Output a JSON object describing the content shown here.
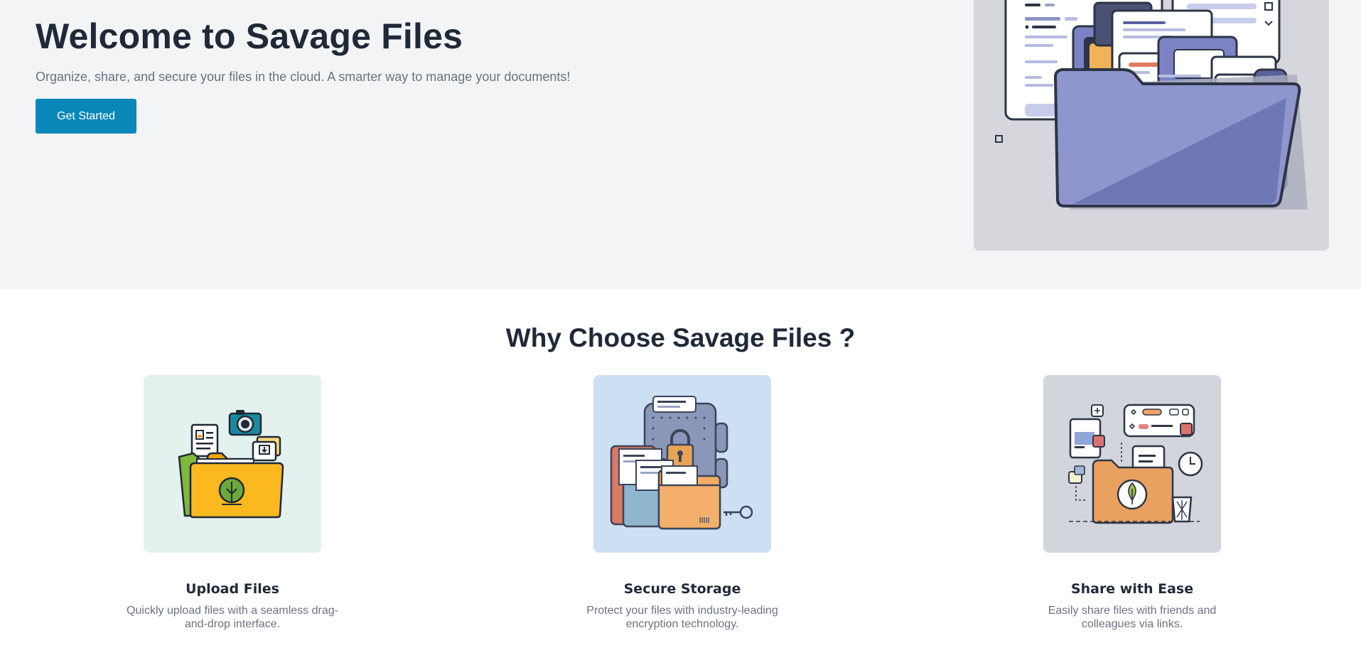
{
  "hero": {
    "title": "Welcome to Savage Files",
    "subtitle": "Organize, share, and secure your files in the cloud. A smarter way to manage your documents!",
    "cta_label": "Get Started"
  },
  "features": {
    "heading": "Why Choose Savage Files ?",
    "items": [
      {
        "title": "Upload Files",
        "description": "Quickly upload files with a seamless drag-and-drop interface."
      },
      {
        "title": "Secure Storage",
        "description": "Protect your files with industry-leading encryption technology."
      },
      {
        "title": "Share with Ease",
        "description": "Easily share files with friends and colleagues via links."
      }
    ]
  },
  "colors": {
    "primary_button": "#0788b8",
    "hero_background": "#f3f4f6",
    "heading_text": "#1f2937",
    "muted_text": "#6b7280",
    "card1_bg": "#e3f2ee",
    "card2_bg": "#cddff2",
    "card3_bg": "#d2d5dc"
  },
  "icons": {
    "hero": "folder-documents-illustration",
    "upload": "upload-folder-illustration",
    "secure": "secure-vault-illustration",
    "share": "share-folder-illustration"
  }
}
